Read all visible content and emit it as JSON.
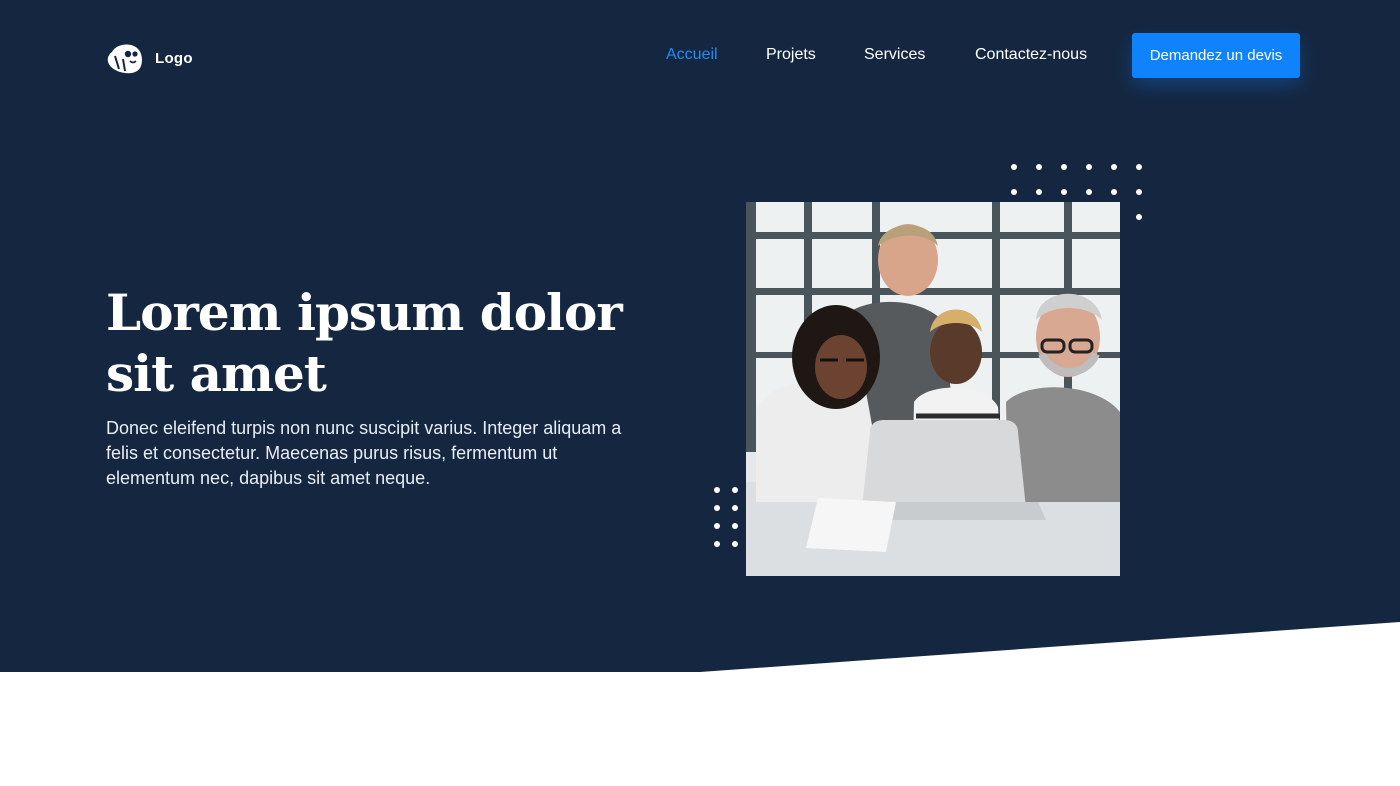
{
  "brand": {
    "icon": "logo-icon",
    "name": "Logo"
  },
  "nav": {
    "items": [
      {
        "label": "Accueil",
        "active": true
      },
      {
        "label": "Projets",
        "active": false
      },
      {
        "label": "Services",
        "active": false
      },
      {
        "label": "Contactez-nous",
        "active": false
      }
    ],
    "cta_label": "Demandez un devis"
  },
  "hero": {
    "title_line1": "Lorem ipsum dolor",
    "title_line2": "sit amet",
    "description": "Donec eleifend turpis non nunc suscipit varius. Integer aliquam a felis et consectetur. Maecenas purus risus, fermentum ut elementum nec, dapibus sit amet neque.",
    "image": "team-working-around-laptop-photo"
  },
  "colors": {
    "hero_background": "#152740",
    "accent": "#0f83fb",
    "active_link": "#1f8cf5",
    "text": "#ffffff"
  }
}
